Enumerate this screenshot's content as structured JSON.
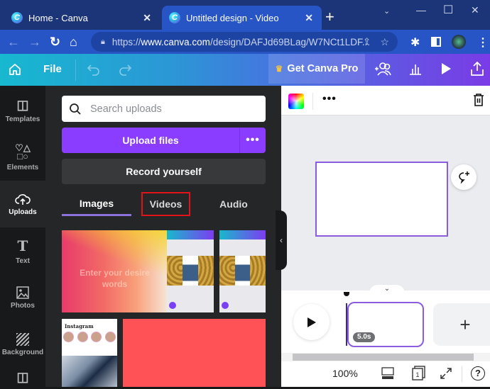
{
  "browser": {
    "tabs": [
      {
        "title": "Home - Canva",
        "active": false
      },
      {
        "title": "Untitled design - Video",
        "active": true
      }
    ],
    "new_tab_label": "+",
    "url_prefix": "https://",
    "url_host": "www.canva.com",
    "url_path": "/design/DAFJd69BLag/W7NCt1LDF...",
    "window_controls": [
      "chevron-down",
      "minimize",
      "maximize",
      "close"
    ]
  },
  "header": {
    "file_label": "File",
    "get_pro_label": "Get Canva Pro",
    "icons": [
      "home-icon",
      "undo-icon",
      "redo-icon",
      "crown-icon",
      "share-people-icon",
      "insights-icon",
      "present-icon",
      "share-upload-icon"
    ]
  },
  "rail": {
    "items": [
      {
        "label": "Templates",
        "icon": "templates-icon",
        "active": false
      },
      {
        "label": "Elements",
        "icon": "elements-icon",
        "active": false
      },
      {
        "label": "Uploads",
        "icon": "cloud-upload-icon",
        "active": true
      },
      {
        "label": "Text",
        "icon": "text-icon",
        "active": false
      },
      {
        "label": "Photos",
        "icon": "photos-icon",
        "active": false
      },
      {
        "label": "Background",
        "icon": "background-icon",
        "active": false
      }
    ]
  },
  "uploads": {
    "search_placeholder": "Search uploads",
    "upload_label": "Upload files",
    "more_label": "•••",
    "record_label": "Record yourself",
    "tabs": [
      {
        "label": "Images",
        "active": true
      },
      {
        "label": "Videos",
        "active": false,
        "highlighted": true
      },
      {
        "label": "Audio",
        "active": false
      }
    ],
    "thumbnails": [
      {
        "type": "gradient-text",
        "text": "Enter your desire words"
      },
      {
        "type": "phone-screenshot"
      },
      {
        "type": "phone-screenshot"
      },
      {
        "type": "instagram-screenshot",
        "text": "Instagram"
      },
      {
        "type": "solid-color",
        "color": "#ff5257"
      }
    ]
  },
  "editor": {
    "more_label": "•••",
    "timeline": {
      "clip_duration": "5.0s",
      "add_label": "+"
    },
    "footer": {
      "zoom": "100%",
      "page_count": "1",
      "help_label": "?"
    }
  },
  "colors": {
    "accent_purple": "#8b3dff",
    "selection": "#8b5be0",
    "highlight_box": "#e0141b",
    "panel_bg": "#252627"
  }
}
